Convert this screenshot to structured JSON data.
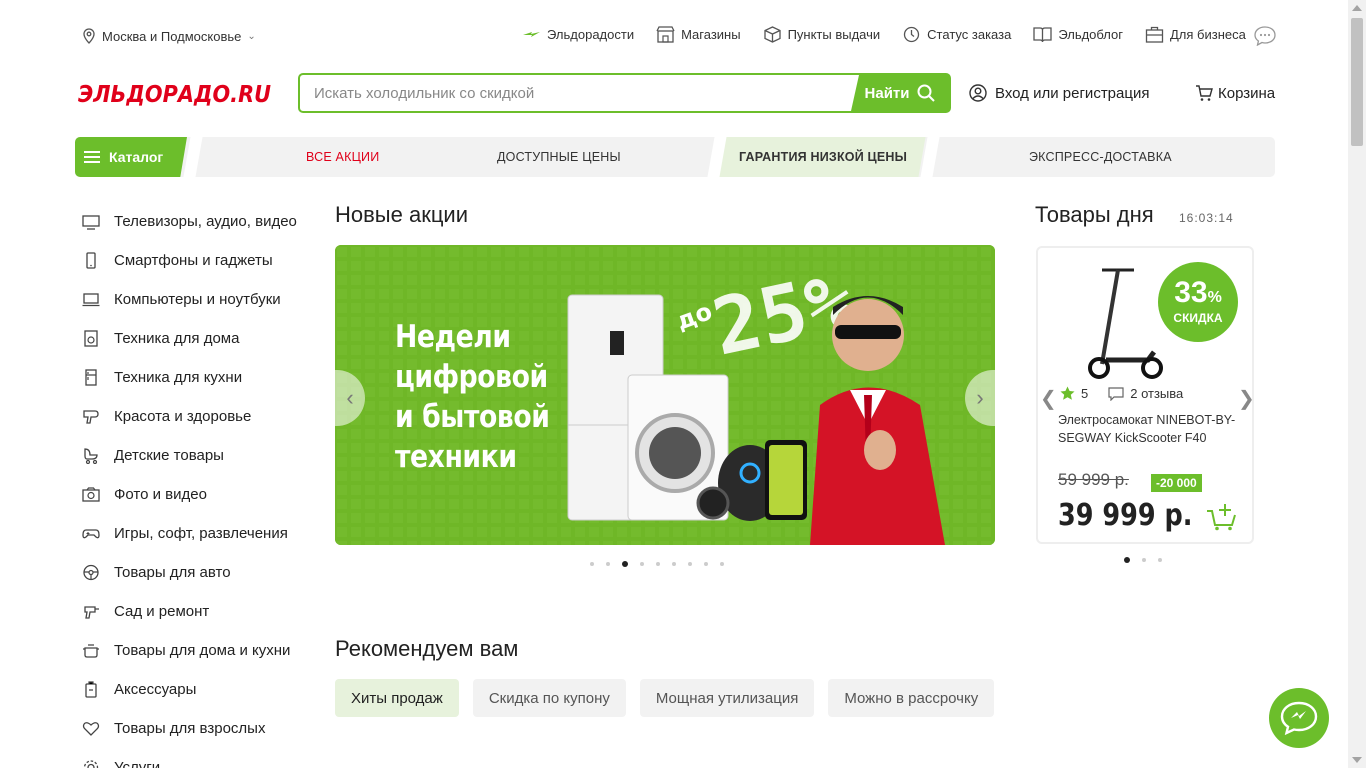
{
  "region": {
    "label": "Москва и Подмосковье"
  },
  "top_links": [
    {
      "icon": "lightning-icon",
      "label": "Эльдорадости"
    },
    {
      "icon": "store-icon",
      "label": "Магазины"
    },
    {
      "icon": "box-icon",
      "label": "Пункты выдачи"
    },
    {
      "icon": "clock-icon",
      "label": "Статус заказа"
    },
    {
      "icon": "book-icon",
      "label": "Эльдоблог"
    },
    {
      "icon": "briefcase-icon",
      "label": "Для бизнеса"
    }
  ],
  "header": {
    "logo_text": "ЭЛЬДОРАДО.RU",
    "search_placeholder": "Искать холодильник со скидкой",
    "search_button": "Найти",
    "login": "Вход или регистрация",
    "cart": "Корзина"
  },
  "nav": {
    "catalog": "Каталог",
    "links": [
      "ВСЕ АКЦИИ",
      "ДОСТУПНЫЕ ЦЕНЫ",
      "ГАРАНТИЯ НИЗКОЙ ЦЕНЫ",
      "ЭКСПРЕСС-ДОСТАВКА"
    ]
  },
  "categories": [
    "Телевизоры, аудио, видео",
    "Смартфоны и гаджеты",
    "Компьютеры и ноутбуки",
    "Техника для дома",
    "Техника для кухни",
    "Красота и здоровье",
    "Детские товары",
    "Фото и видео",
    "Игры, софт, развлечения",
    "Товары для авто",
    "Сад и ремонт",
    "Товары для дома и кухни",
    "Аксессуары",
    "Товары для взрослых",
    "Услуги"
  ],
  "promos": {
    "title": "Новые акции",
    "banner_lines": [
      "Недели",
      "цифровой",
      "и бытовой",
      "техники"
    ],
    "banner_prefix": "до",
    "banner_number": "25%",
    "dots_count": 9,
    "active_dot": 3
  },
  "deals": {
    "title": "Товары дня",
    "timer": "16:03:14",
    "badge_pct": "33",
    "badge_pct_sign": "%",
    "badge_label": "СКИДКА",
    "rating": "5",
    "reviews": "2 отзыва",
    "product_title": "Электросамокат NINEBOT-BY-SEGWAY KickScooter F40",
    "old_price": "59 999 р.",
    "discount": "-20 000",
    "price": "39 999 р.",
    "dots_count": 3,
    "active_dot": 1
  },
  "recommend": {
    "title": "Рекомендуем вам",
    "tabs": [
      "Хиты продаж",
      "Скидка по купону",
      "Мощная утилизация",
      "Можно в рассрочку"
    ],
    "active_tab": 0
  },
  "colors": {
    "brand_green": "#6cbe2b",
    "brand_red": "#e0001a",
    "light_green": "#e7f2dc"
  }
}
